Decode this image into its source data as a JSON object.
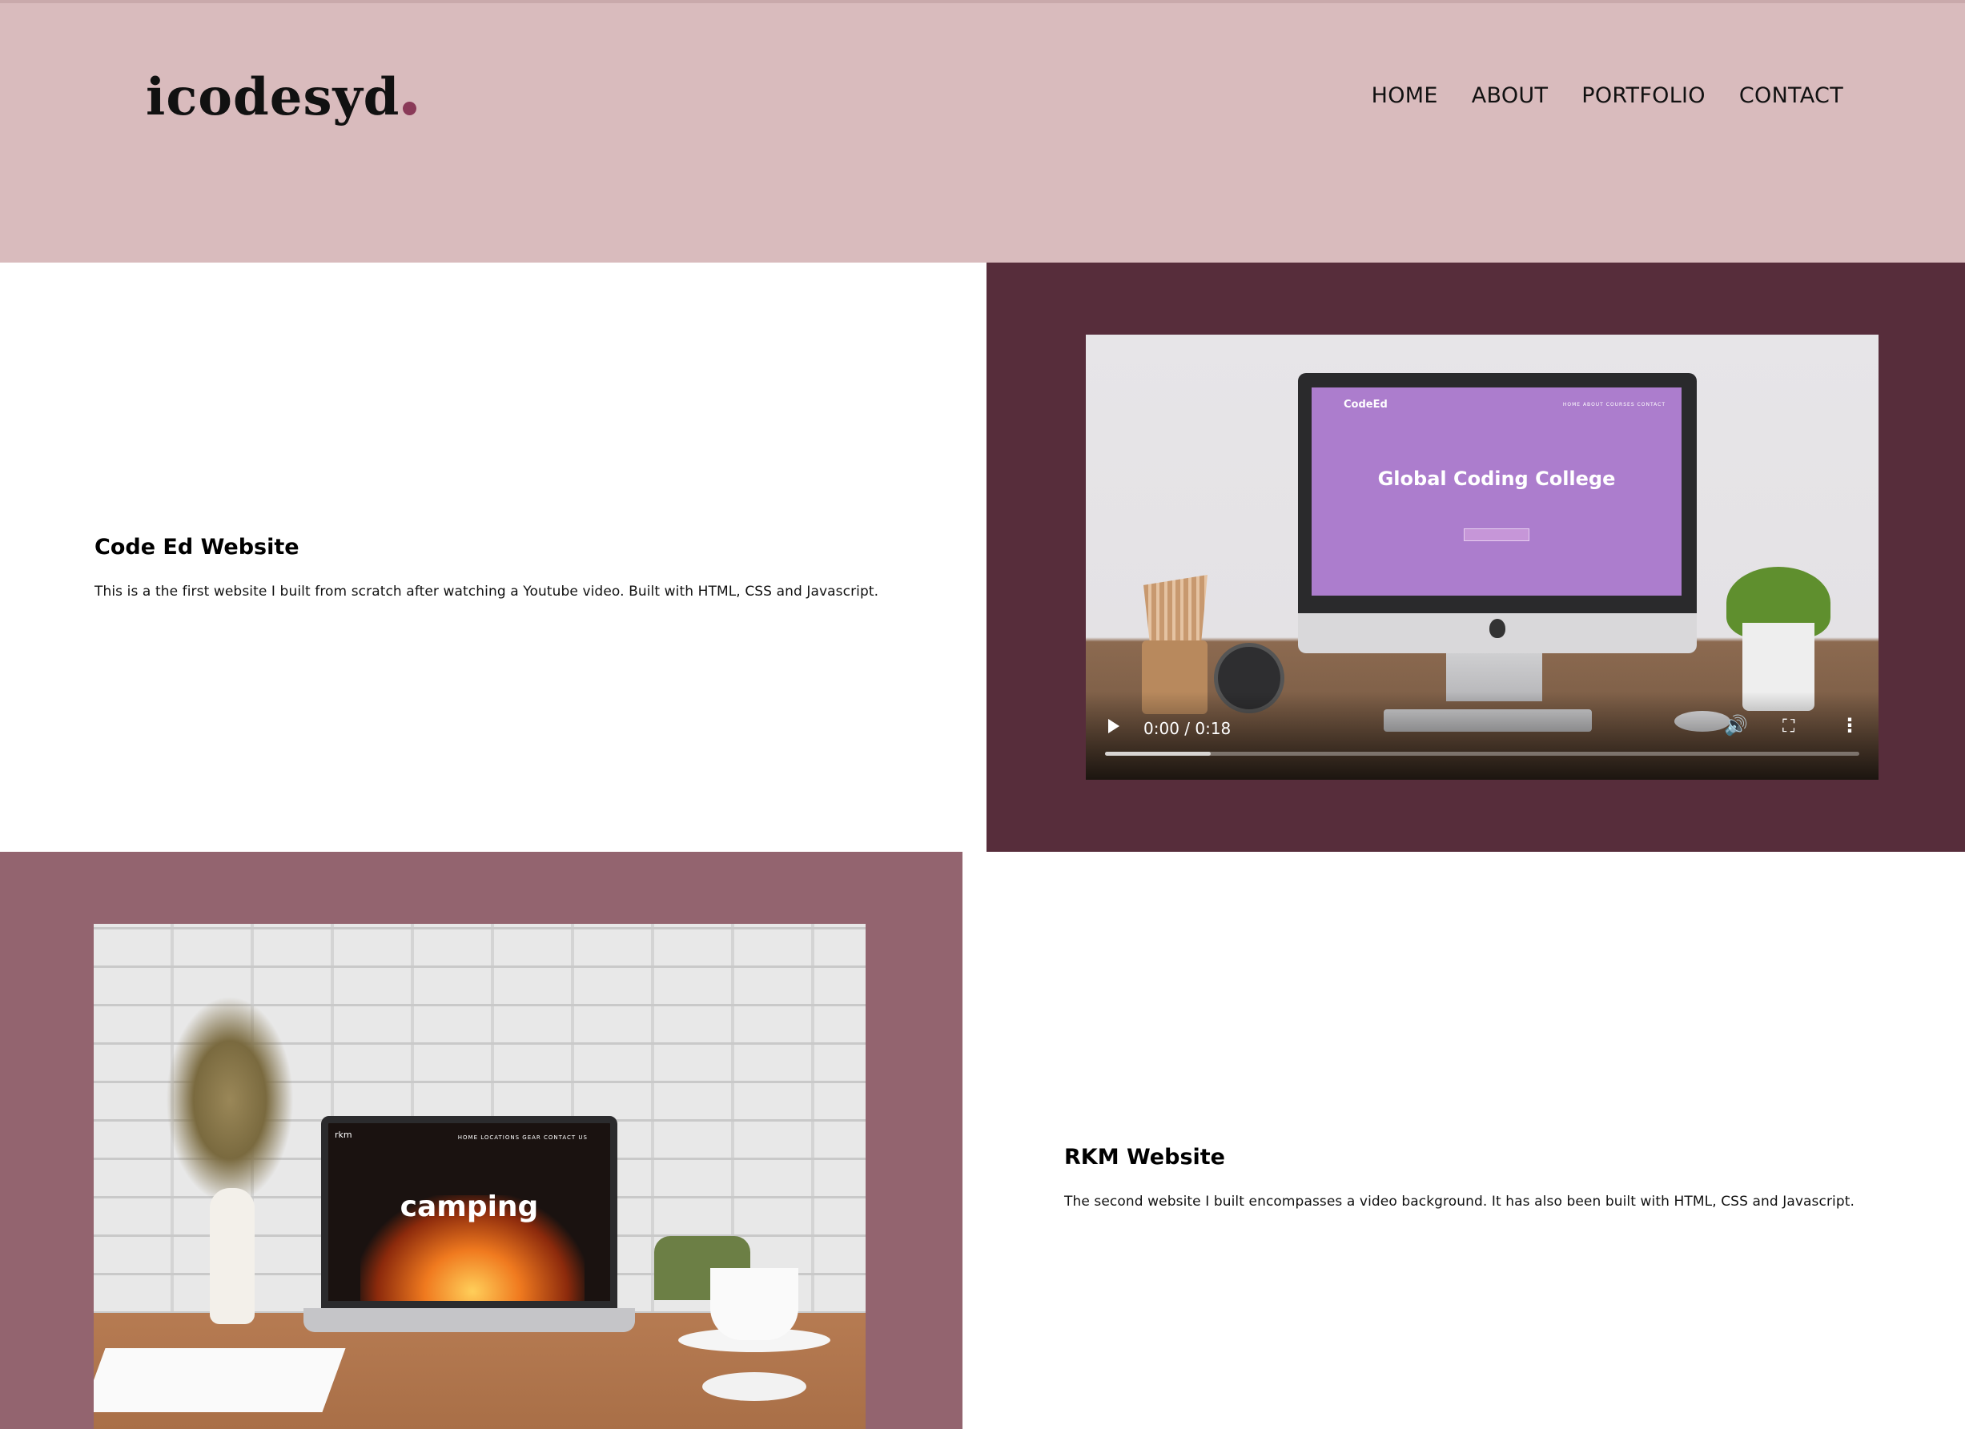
{
  "header": {
    "logo_text": "icodesyd",
    "nav": [
      "HOME",
      "ABOUT",
      "PORTFOLIO",
      "CONTACT"
    ]
  },
  "colors": {
    "header_bg": "#d9bbbd",
    "logo_dot": "#8a3a58",
    "section1_panel": "#572d3b",
    "section2_panel": "#93646f"
  },
  "projects": [
    {
      "title": "Code Ed Website",
      "description": "This is a the first website I built from scratch after watching a Youtube video. Built with HTML, CSS and Javascript.",
      "media": {
        "type": "video",
        "time": "0:00 / 0:18",
        "progress": 0.14,
        "screen_brand": "CodeEd",
        "screen_nav": "HOME  ABOUT  COURSES  CONTACT",
        "screen_heading": "Global Coding College",
        "icons": [
          "play-icon",
          "volume-icon",
          "fullscreen-icon",
          "more-options-icon"
        ]
      }
    },
    {
      "title": "RKM Website",
      "description": "The second website I built encompasses a video background. It has also been built with HTML, CSS and Javascript.",
      "media": {
        "type": "image",
        "laptop_logo": "rkm",
        "laptop_nav": "HOME  LOCATIONS  GEAR  CONTACT US",
        "laptop_heading": "camping"
      }
    }
  ]
}
